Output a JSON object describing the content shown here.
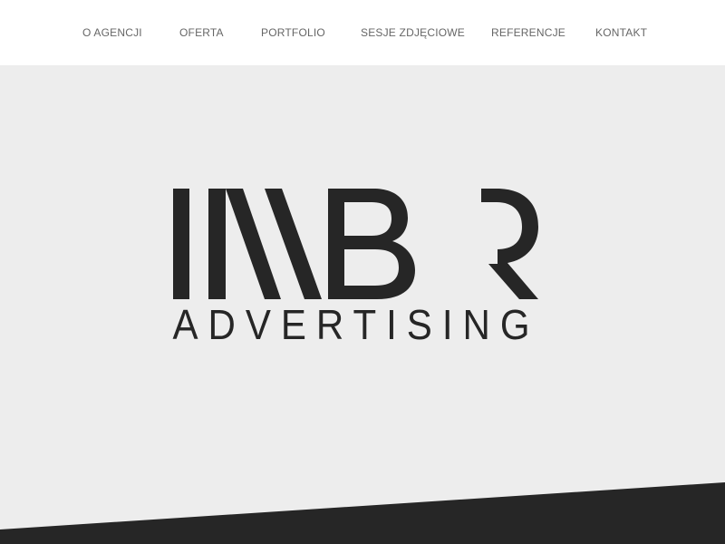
{
  "nav": {
    "items": [
      {
        "label": "O AGENCJI"
      },
      {
        "label": "OFERTA"
      },
      {
        "label": "PORTFOLIO"
      },
      {
        "label": "SESJE ZDJĘCIOWE"
      },
      {
        "label": "REFERENCJE"
      },
      {
        "label": "KONTAKT"
      }
    ]
  },
  "logo": {
    "wordmark": "IMBR",
    "tagline": "ADVERTISING",
    "color": "#262626"
  },
  "colors": {
    "nav_bg": "#ffffff",
    "hero_bg": "#ededed",
    "band": "#262626",
    "nav_text": "#666666"
  }
}
